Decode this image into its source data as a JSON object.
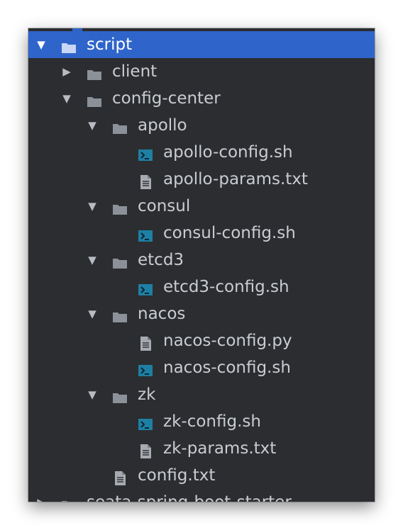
{
  "tree": {
    "rows": [
      {
        "label": "script",
        "kind": "folder",
        "expanded": true,
        "selected": true,
        "depth": 0,
        "arrow": "▼",
        "icon": "folder-icon"
      },
      {
        "label": "client",
        "kind": "folder",
        "expanded": false,
        "depth": 1,
        "arrow": "▶",
        "icon": "folder-icon"
      },
      {
        "label": "config-center",
        "kind": "folder",
        "expanded": true,
        "depth": 1,
        "arrow": "▼",
        "icon": "folder-icon"
      },
      {
        "label": "apollo",
        "kind": "folder",
        "expanded": true,
        "depth": 2,
        "arrow": "▼",
        "icon": "folder-icon"
      },
      {
        "label": "apollo-config.sh",
        "kind": "shell",
        "depth": 3,
        "icon": "terminal-file-icon"
      },
      {
        "label": "apollo-params.txt",
        "kind": "text",
        "depth": 3,
        "icon": "text-file-icon"
      },
      {
        "label": "consul",
        "kind": "folder",
        "expanded": true,
        "depth": 2,
        "arrow": "▼",
        "icon": "folder-icon"
      },
      {
        "label": "consul-config.sh",
        "kind": "shell",
        "depth": 3,
        "icon": "terminal-file-icon"
      },
      {
        "label": "etcd3",
        "kind": "folder",
        "expanded": true,
        "depth": 2,
        "arrow": "▼",
        "icon": "folder-icon"
      },
      {
        "label": "etcd3-config.sh",
        "kind": "shell",
        "depth": 3,
        "icon": "terminal-file-icon"
      },
      {
        "label": "nacos",
        "kind": "folder",
        "expanded": true,
        "depth": 2,
        "arrow": "▼",
        "icon": "folder-icon"
      },
      {
        "label": "nacos-config.py",
        "kind": "text",
        "depth": 3,
        "icon": "text-file-icon"
      },
      {
        "label": "nacos-config.sh",
        "kind": "shell",
        "depth": 3,
        "icon": "terminal-file-icon"
      },
      {
        "label": "zk",
        "kind": "folder",
        "expanded": true,
        "depth": 2,
        "arrow": "▼",
        "icon": "folder-icon"
      },
      {
        "label": "zk-config.sh",
        "kind": "shell",
        "depth": 3,
        "icon": "terminal-file-icon"
      },
      {
        "label": "zk-params.txt",
        "kind": "text",
        "depth": 3,
        "icon": "text-file-icon"
      },
      {
        "label": "config.txt",
        "kind": "text",
        "depth": 2,
        "icon": "text-file-icon"
      },
      {
        "label": "seata-spring-boot-starter",
        "kind": "folder",
        "expanded": false,
        "depth": 0,
        "arrow": "▶",
        "icon": "folder-icon",
        "cutoff": true
      }
    ]
  },
  "colors": {
    "panel_bg": "#2b2d30",
    "selection": "#2f65ca",
    "text": "#c9ccd1",
    "folder": "#8c9199",
    "shell_icon": "#1f7fa3",
    "file_icon": "#a7abb1"
  }
}
